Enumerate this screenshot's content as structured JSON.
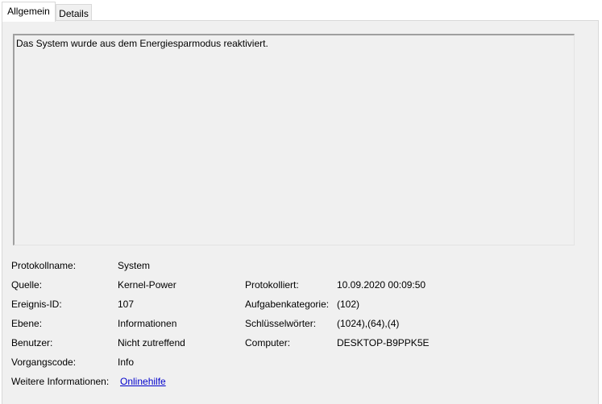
{
  "tabs": [
    {
      "label": "Allgemein",
      "active": true
    },
    {
      "label": "Details",
      "active": false
    }
  ],
  "description": "Das System wurde aus dem Energiesparmodus reaktiviert.",
  "properties": {
    "log_name_label": "Protokollname:",
    "log_name_value": "System",
    "source_label": "Quelle:",
    "source_value": "Kernel-Power",
    "logged_label": "Protokolliert:",
    "logged_value": "10.09.2020 00:09:50",
    "event_id_label": "Ereignis-ID:",
    "event_id_value": "107",
    "task_category_label": "Aufgabenkategorie:",
    "task_category_value": "(102)",
    "level_label": "Ebene:",
    "level_value": "Informationen",
    "keywords_label": "Schlüsselwörter:",
    "keywords_value": "(1024),(64),(4)",
    "user_label": "Benutzer:",
    "user_value": "Nicht zutreffend",
    "computer_label": "Computer:",
    "computer_value": "DESKTOP-B9PPK5E",
    "opcode_label": "Vorgangscode:",
    "opcode_value": "Info",
    "more_info_label": "Weitere Informationen:",
    "more_info_link": "Onlinehilfe"
  },
  "colors": {
    "panel_background": "#f0f0f0",
    "tab_border": "#d9d9d9",
    "link": "#0000cc"
  }
}
